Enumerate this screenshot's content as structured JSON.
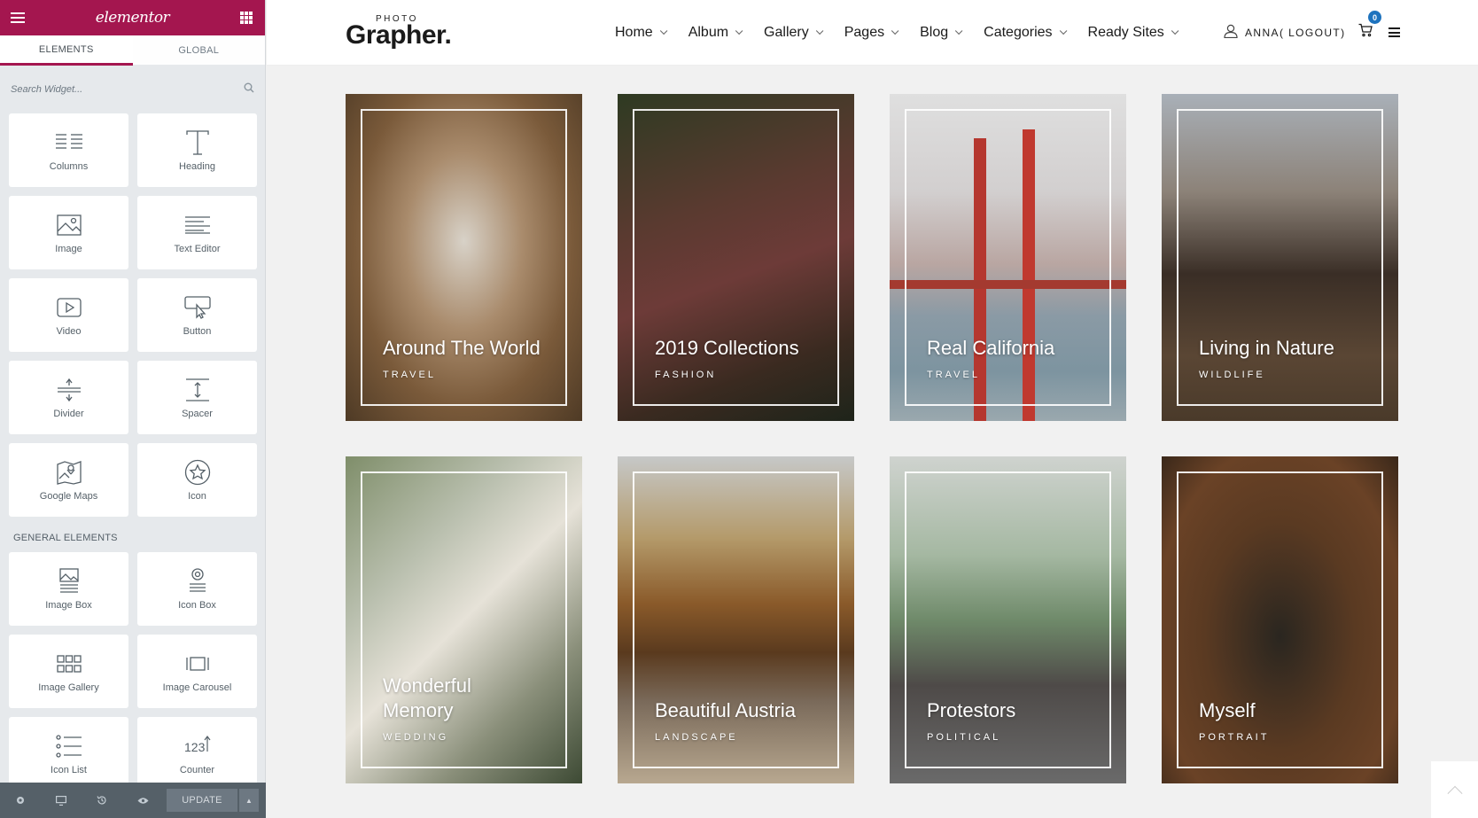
{
  "editor": {
    "brand": "elementor",
    "tabs": [
      "ELEMENTS",
      "GLOBAL"
    ],
    "search_placeholder": "Search Widget...",
    "basic_widgets": [
      {
        "label": "Columns",
        "icon": "columns-icon"
      },
      {
        "label": "Heading",
        "icon": "heading-icon"
      },
      {
        "label": "Image",
        "icon": "image-icon"
      },
      {
        "label": "Text Editor",
        "icon": "text-editor-icon"
      },
      {
        "label": "Video",
        "icon": "video-icon"
      },
      {
        "label": "Button",
        "icon": "button-icon"
      },
      {
        "label": "Divider",
        "icon": "divider-icon"
      },
      {
        "label": "Spacer",
        "icon": "spacer-icon"
      },
      {
        "label": "Google Maps",
        "icon": "google-maps-icon"
      },
      {
        "label": "Icon",
        "icon": "star-icon"
      }
    ],
    "general_section_title": "GENERAL ELEMENTS",
    "general_widgets": [
      {
        "label": "Image Box",
        "icon": "image-box-icon"
      },
      {
        "label": "Icon Box",
        "icon": "icon-box-icon"
      },
      {
        "label": "Image Gallery",
        "icon": "image-gallery-icon"
      },
      {
        "label": "Image Carousel",
        "icon": "image-carousel-icon"
      },
      {
        "label": "Icon List",
        "icon": "icon-list-icon"
      },
      {
        "label": "Counter",
        "icon": "counter-icon"
      }
    ],
    "update_label": "UPDATE",
    "brand_color": "#a4164f"
  },
  "site": {
    "logo_small": "PHOTO",
    "logo_big": "Grapher.",
    "nav": [
      "Home",
      "Album",
      "Gallery",
      "Pages",
      "Blog",
      "Categories",
      "Ready Sites"
    ],
    "account_label": "ANNA( LOGOUT)",
    "cart_count": "0",
    "cards": [
      {
        "title": "Around The World",
        "category": "TRAVEL"
      },
      {
        "title": "2019 Collections",
        "category": "FASHION"
      },
      {
        "title": "Real California",
        "category": "TRAVEL"
      },
      {
        "title": "Living in Nature",
        "category": "WILDLIFE"
      },
      {
        "title": "Wonderful Memory",
        "category": "WEDDING"
      },
      {
        "title": "Beautiful Austria",
        "category": "LANDSCAPE"
      },
      {
        "title": "Protestors",
        "category": "POLITICAL"
      },
      {
        "title": "Myself",
        "category": "PORTRAIT"
      }
    ]
  }
}
